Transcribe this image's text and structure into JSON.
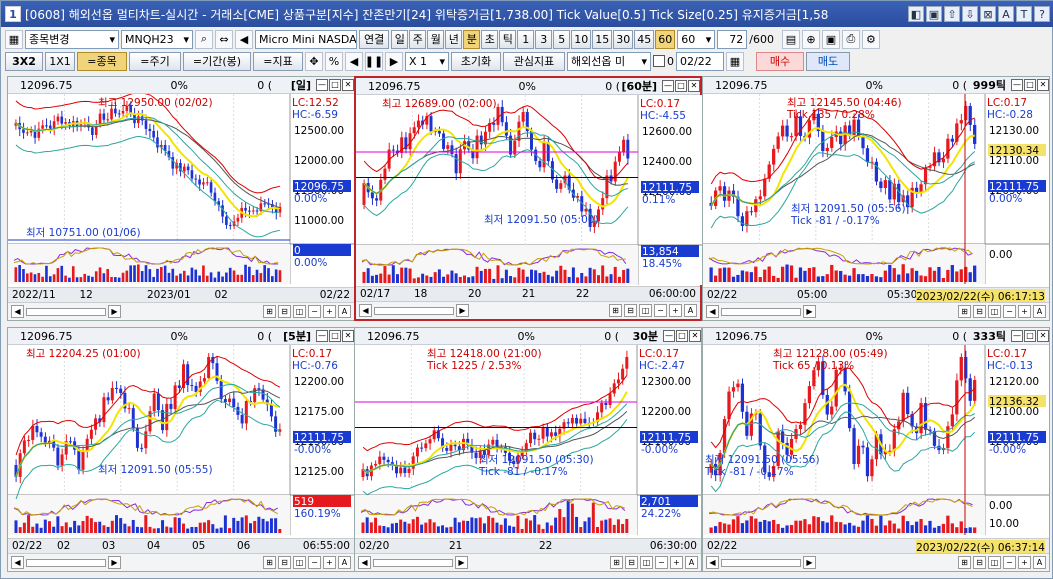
{
  "app": {
    "window_num": "1",
    "title": "[0608] 해외선옵 멀티차트-실시간 - 거래소[CME] 상품구분[지수] 잔존만기[24] 위탁증거금[1,738.00] Tick Value[0.5] Tick Size[0.25] 유지증거금[1,58",
    "title_buttons": [
      "◧",
      "▣",
      "⇧",
      "⇩",
      "⊠",
      "A",
      "T",
      "?"
    ]
  },
  "toolbar1": {
    "search_label": "종목변경",
    "symbol": "MNQH23",
    "name": "Micro Mini NASDAQ",
    "link": "연결",
    "periods": [
      "일",
      "주",
      "월",
      "년",
      "분",
      "초",
      "틱",
      "1",
      "3",
      "5",
      "10",
      "15",
      "30",
      "45",
      "60"
    ],
    "selected_period_unit": "분",
    "selected_interval": "60",
    "interval_value": "60",
    "count": "72",
    "count_max": "/600"
  },
  "toolbar2": {
    "layout": "3X2",
    "single": "1X1",
    "item": "=종목",
    "cycle": "=주기",
    "range": "=기간(봉)",
    "indicator": "=지표",
    "percent": "%",
    "multiplier": "X 1",
    "reset": "초기화",
    "watch": "관심지표",
    "market": "해외선옵 미",
    "check_value": "0",
    "date": "02/22",
    "buy": "매수",
    "sell": "매도"
  },
  "panels": [
    {
      "price": "12096.75",
      "change": "0%",
      "vol": "0 (",
      "period": "[일]",
      "lc": "LC:12.52",
      "hc": "HC:-6.59",
      "axis": [
        "12500.00",
        "12000.00",
        "11500.00",
        "11000.00"
      ],
      "cur_price": "12096.75",
      "cur_pct": "0.00%",
      "high_label": "최고 12950.00 (02/02)",
      "low_label": "최저 10751.00 (01/06)",
      "vol_box": "0",
      "vol_pct": "0.00%",
      "x_labels": [
        "2022/11",
        "12",
        "2023/01",
        "02"
      ],
      "x_end": "02/22",
      "color_up": "#e6191e",
      "color_down": "#1e32d2"
    },
    {
      "price": "12096.75",
      "change": "0%",
      "vol": "0 (",
      "period": "[60분]",
      "lc": "LC:0.17",
      "hc": "HC:-4.55",
      "axis": [
        "12600.00",
        "12400.00",
        "12200.00"
      ],
      "cur_price": "12111.75",
      "cur_pct": "0.11%",
      "high_label": "최고 12689.00 (02:00)",
      "low_label": "최저 12091.50 (05:00)",
      "vol_box": "13,854",
      "vol_pct": "18.45%",
      "x_labels": [
        "02/17",
        "18",
        "20",
        "21",
        "22"
      ],
      "x_end": "06:00:00"
    },
    {
      "price": "12096.75",
      "change": "0%",
      "vol": "0 (",
      "period": "999틱",
      "lc": "LC:0.17",
      "hc": "HC:-0.28",
      "axis": [
        "12130.00",
        "12110.00",
        "12090.00"
      ],
      "cur_price": "12111.75",
      "cur_pct": "0.00%",
      "cross_price": "12130.34",
      "high_label": "최고 12145.50 (04:46)",
      "high_tick": "Tick 135 / 0.28%",
      "low_label": "최저 12091.50 (05:56)",
      "low_tick": "Tick -81 / -0.17%",
      "osc_axis": "0.00",
      "x_labels": [
        "02/22",
        "05:00",
        "05:30"
      ],
      "x_end": "2023/02/22(수) 06:17:13"
    },
    {
      "price": "12096.75",
      "change": "0%",
      "vol": "0 (",
      "period": "[5분]",
      "lc": "LC:0.17",
      "hc": "HC:-0.76",
      "axis": [
        "12200.00",
        "12175.00",
        "12150.00",
        "12125.00"
      ],
      "cur_price": "12111.75",
      "cur_pct": "-0.00%",
      "high_label": "최고 12204.25 (01:00)",
      "low_label": "최저 12091.50 (05:55)",
      "vol_box": "519",
      "vol_pct": "160.19%",
      "x_labels": [
        "02/22",
        "02",
        "03",
        "04",
        "05",
        "06"
      ],
      "x_end": "06:55:00"
    },
    {
      "price": "12096.75",
      "change": "0%",
      "vol": "0 (",
      "period": "30분",
      "lc": "LC:0.17",
      "hc": "HC:-2.47",
      "axis": [
        "12300.00",
        "12200.00",
        "12100.00"
      ],
      "cur_price": "12111.75",
      "cur_pct": "-0.00%",
      "high_label": "최고 12418.00 (21:00)",
      "high_tick": "Tick 1225 / 2.53%",
      "low_label": "최저 12091.50 (05:30)",
      "low_tick": "Tick -81 / -0.17%",
      "vol_box": "2,701",
      "vol_pct": "24.22%",
      "x_labels": [
        "02/20",
        "21",
        "22"
      ],
      "x_end": "06:30:00"
    },
    {
      "price": "12096.75",
      "change": "0%",
      "vol": "0 (",
      "period": "333틱",
      "lc": "LC:0.17",
      "hc": "HC:-0.13",
      "axis": [
        "12120.00",
        "12100.00",
        "12090.00"
      ],
      "cur_price": "12111.75",
      "cur_pct": "-0.00%",
      "cross_price": "12136.32",
      "high_label": "최고 12128.00 (05:49)",
      "high_tick": "Tick 65 / 0.13%",
      "low_label": "최저 12091.50 (05:56)",
      "low_tick": "Tick -81 / -0.17%",
      "osc_axis": "0.00",
      "osc_axis2": "10.00",
      "x_labels": [
        "02/22"
      ],
      "x_end": "2023/02/22(수) 06:37:14"
    }
  ]
}
